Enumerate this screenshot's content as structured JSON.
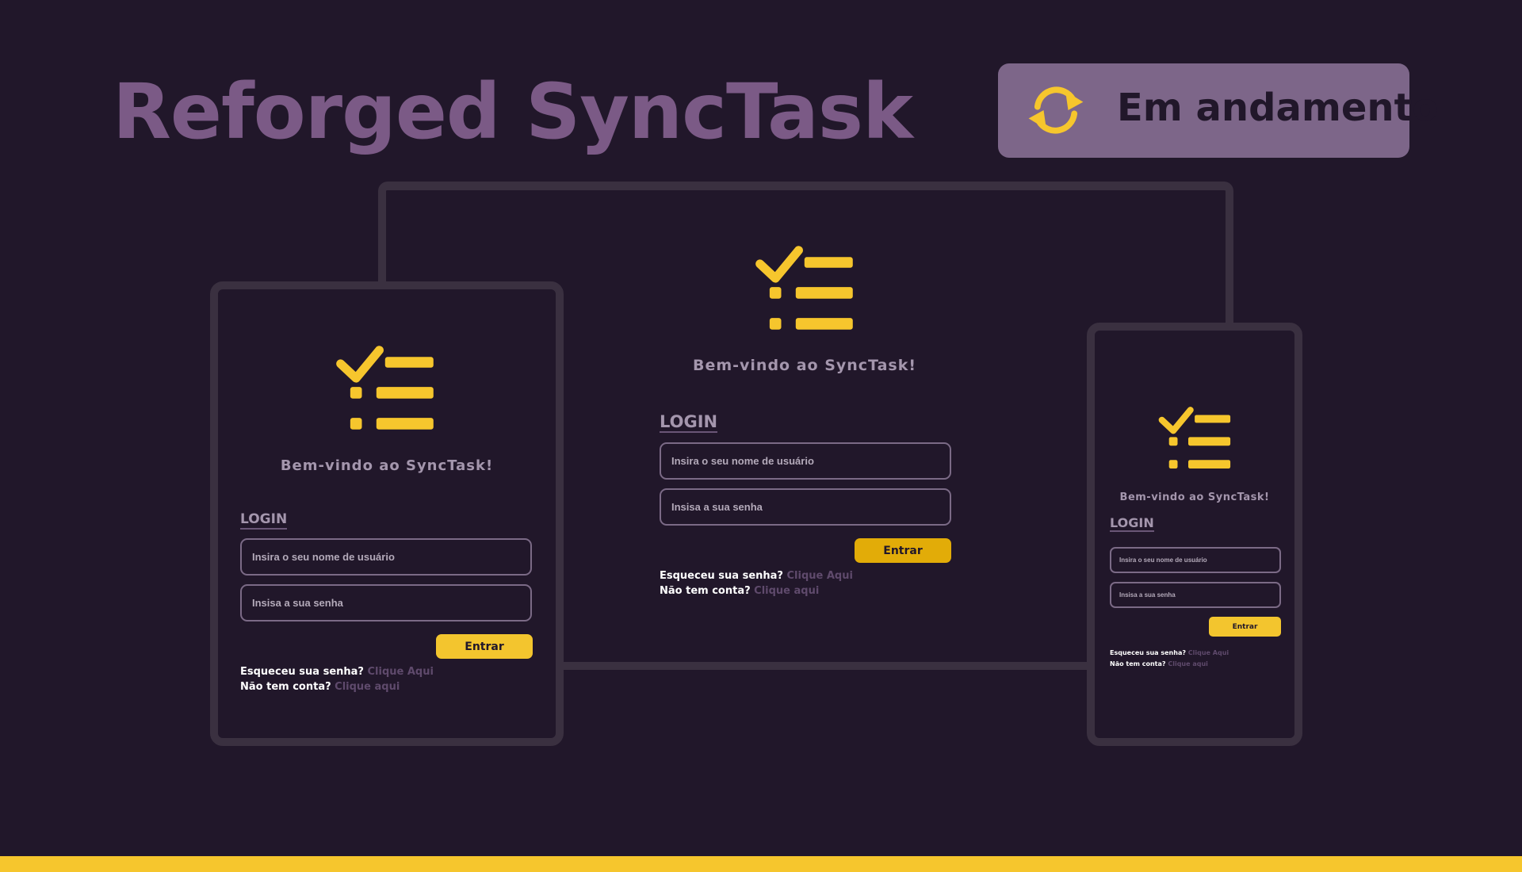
{
  "header": {
    "title": "Reforged SyncTask",
    "status": "Em andamento"
  },
  "login_screen": {
    "welcome": "Bem-vindo ao SyncTask!",
    "login_heading": "LOGIN",
    "username_placeholder": "Insira o seu nome de usuário",
    "password_placeholder": "Insisa a sua senha",
    "submit_label": "Entrar",
    "forgot_text": "Esqueceu sua senha?",
    "forgot_link": "Clique Aqui",
    "signup_text": "Não tem conta?",
    "signup_link": "Clique aqui"
  },
  "icons": {
    "status": "refresh-icon",
    "logo": "checklist-icon"
  },
  "colors": {
    "background": "#21172a",
    "accent": "#f6c62d",
    "title": "#7b5a86",
    "badge": "#7d6689"
  }
}
